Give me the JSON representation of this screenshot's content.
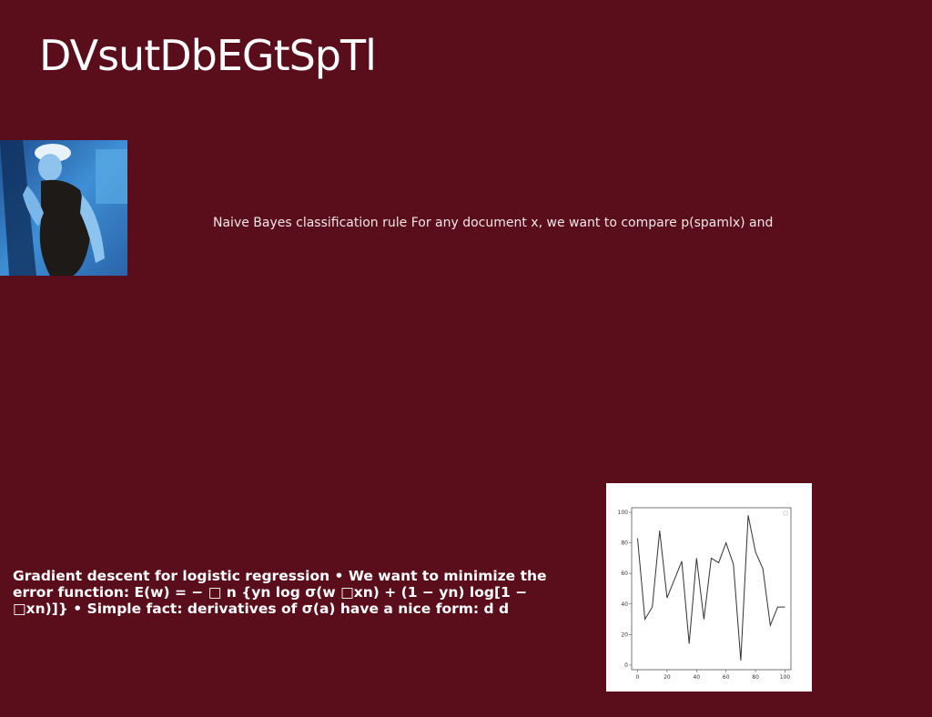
{
  "slide": {
    "title": "DVsutDbEGtSpTl",
    "text_1": "Naive Bayes classification rule For any document x, we want to compare p(spamlx) and",
    "text_2": "Gradient descent for logistic regression • We want to minimize the error function: E(w) = − □ n {yn log σ(w □xn) + (1 − yn) log[1 − □xn)]} • Simple fact: derivatives of σ(a) have a nice form: d d",
    "photo_icon": "person-photo",
    "colors": {
      "background": "#5a0e1c",
      "text": "#ffffff"
    }
  },
  "chart_data": {
    "type": "line",
    "x": [
      0,
      5,
      10,
      15,
      20,
      25,
      30,
      35,
      40,
      45,
      50,
      55,
      60,
      65,
      70,
      75,
      80,
      85,
      90,
      95,
      100
    ],
    "values": [
      83,
      30,
      38,
      88,
      44,
      56,
      68,
      14,
      70,
      30,
      70,
      67,
      80,
      66,
      3,
      98,
      74,
      63,
      26,
      38,
      38
    ],
    "xticks": [
      "0",
      "20",
      "40",
      "60",
      "80",
      "100"
    ],
    "yticks": [
      "0",
      "20",
      "40",
      "60",
      "80",
      "100"
    ],
    "xlim": [
      -4,
      104
    ],
    "ylim": [
      -3,
      103
    ],
    "title": "",
    "xlabel": "",
    "ylabel": "",
    "line_color": "#333333"
  }
}
